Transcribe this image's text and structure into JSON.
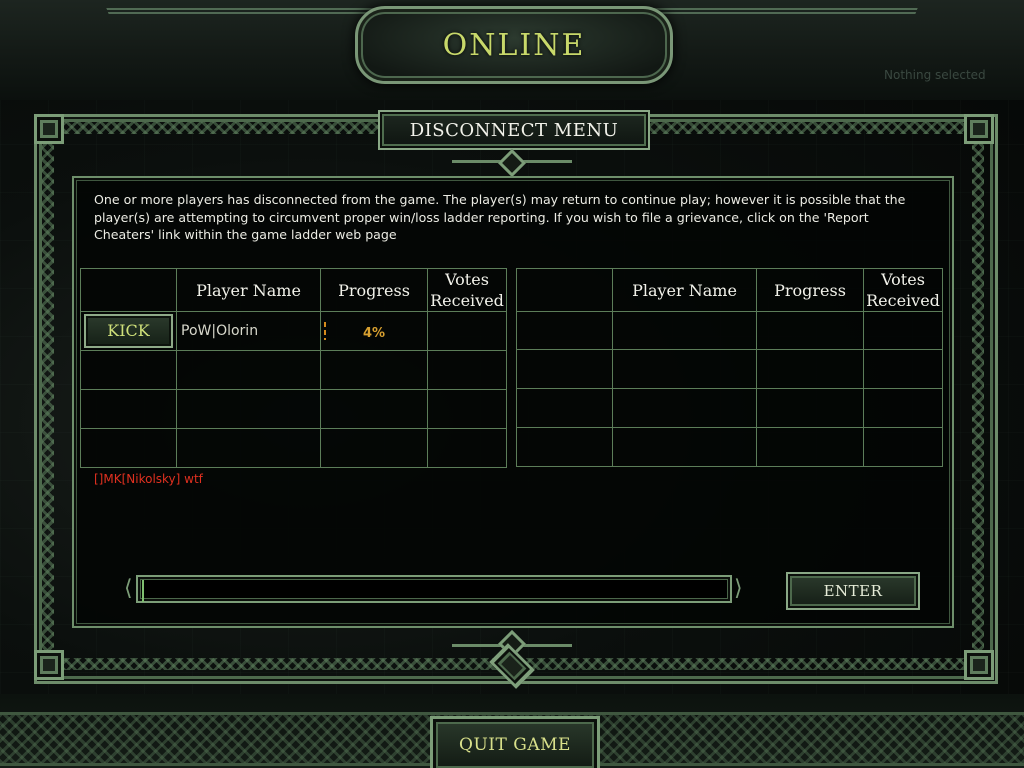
{
  "header": {
    "title": "ONLINE",
    "ghost_status": "Nothing selected"
  },
  "panel": {
    "title": "DISCONNECT MENU",
    "message": "One or more players has disconnected from the game.  The player(s) may return to continue play; however it is possible that the player(s) are attempting to circumvent proper win/loss ladder reporting.  If you wish to file a grievance, click on the 'Report Cheaters' link within the game ladder web page"
  },
  "tables": {
    "left": {
      "columns": [
        "",
        "Player Name",
        "Progress",
        "Votes Received"
      ],
      "rows": [
        {
          "kick_label": "KICK",
          "player_name": "PoW|Olorin",
          "progress": "4%",
          "progress_value": 0.04,
          "votes": ""
        },
        {
          "kick_label": "",
          "player_name": "",
          "progress": "",
          "votes": ""
        },
        {
          "kick_label": "",
          "player_name": "",
          "progress": "",
          "votes": ""
        },
        {
          "kick_label": "",
          "player_name": "",
          "progress": "",
          "votes": ""
        }
      ]
    },
    "right": {
      "columns": [
        "",
        "Player Name",
        "Progress",
        "Votes Received"
      ],
      "rows": [
        {
          "player_name": "",
          "progress": "",
          "votes": ""
        },
        {
          "player_name": "",
          "progress": "",
          "votes": ""
        },
        {
          "player_name": "",
          "progress": "",
          "votes": ""
        },
        {
          "player_name": "",
          "progress": "",
          "votes": ""
        }
      ]
    }
  },
  "chat": {
    "lines": [
      "[]MK[Nikolsky] wtf"
    ],
    "input_value": ""
  },
  "buttons": {
    "enter": "ENTER",
    "quit": "QUIT GAME"
  },
  "colors": {
    "accent_gold": "#c8d86a",
    "frame_green": "#6d8c6a",
    "chat_red": "#e03020",
    "progress_orange": "#d8a030"
  }
}
